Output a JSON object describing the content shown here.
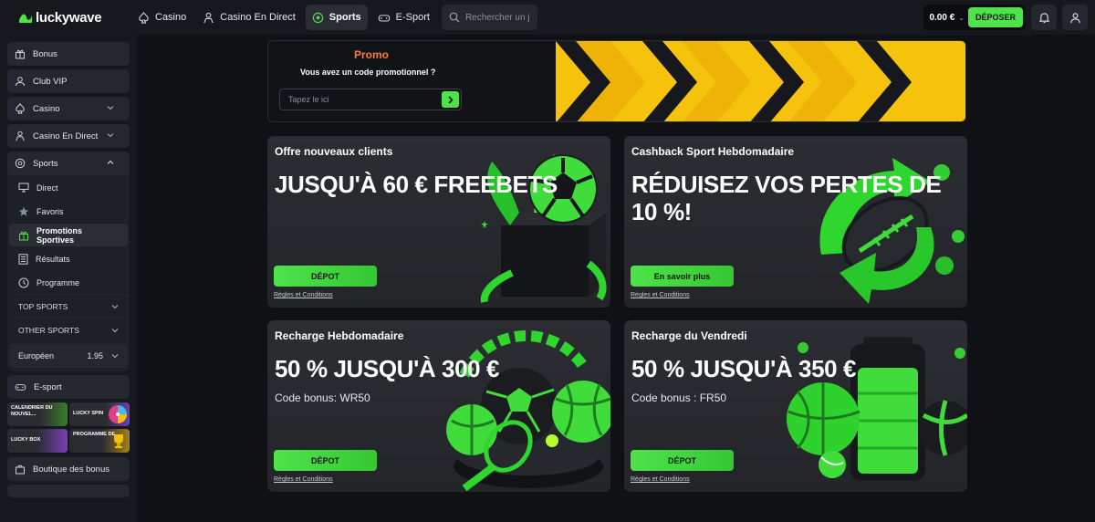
{
  "brand": {
    "name": "luckywave",
    "accent": "#4ee24b"
  },
  "topnav": {
    "items": [
      {
        "label": "Casino",
        "icon": "spade-icon"
      },
      {
        "label": "Casino En Direct",
        "icon": "dealer-icon"
      },
      {
        "label": "Sports",
        "icon": "soccer-ball-icon",
        "active": true
      },
      {
        "label": "E-Sport",
        "icon": "gamepad-icon"
      }
    ],
    "search_placeholder": "Rechercher un jeu"
  },
  "wallet": {
    "balance": "0.00 €",
    "deposit_label": "DÉPOSER"
  },
  "sidebar": {
    "items": [
      {
        "label": "Bonus",
        "icon": "gift-icon"
      },
      {
        "label": "Club VIP",
        "icon": "user-icon"
      },
      {
        "label": "Casino",
        "icon": "spade-icon"
      },
      {
        "label": "Casino En Direct",
        "icon": "dealer-icon"
      }
    ],
    "sports": {
      "label": "Sports",
      "sub": [
        {
          "label": "Direct",
          "icon": "monitor-icon"
        },
        {
          "label": "Favoris",
          "icon": "star-icon"
        },
        {
          "label": "Promotions Sportives",
          "icon": "gift-icon",
          "active": true
        },
        {
          "label": "Résultats",
          "icon": "list-icon"
        },
        {
          "label": "Programme",
          "icon": "clock-icon"
        }
      ],
      "sections": [
        "TOP SPORTS",
        "OTHER SPORTS"
      ],
      "odds_format": "Européen",
      "odds_value": "1.95"
    },
    "esport": "E-sport",
    "tiles": [
      "CALENDRIER DU NOUVEL...",
      "LUCKY SPIN",
      "LUCKY BOX",
      "PROGRAMME DE..."
    ],
    "boutique": "Boutique des bonus"
  },
  "promo": {
    "title": "Promo",
    "question": "Vous avez un code promotionnel ?",
    "input_placeholder": "Tapez le ici"
  },
  "cards": [
    {
      "title": "Offre nouveaux clients",
      "headline": "JUSQU'À 60 € FREEBETS",
      "code": "",
      "button": "DÉPOT",
      "rules": "Règles et Conditions"
    },
    {
      "title": "Cashback Sport Hebdomadaire",
      "headline": "RÉDUISEZ VOS PERTES DE 10 %!",
      "code": "",
      "button": "En savoir plus",
      "rules": "Règles et Conditions"
    },
    {
      "title": "Recharge Hebdomadaire",
      "headline": "50 % JUSQU'À 300 €",
      "code": "Code bonus: WR50",
      "button": "DÉPOT",
      "rules": "Règles et Conditions"
    },
    {
      "title": "Recharge du Vendredi",
      "headline": "50 % JUSQU'À 350 €",
      "code": "Code bonus : FR50",
      "button": "DÉPOT",
      "rules": "Règles et Conditions"
    }
  ]
}
